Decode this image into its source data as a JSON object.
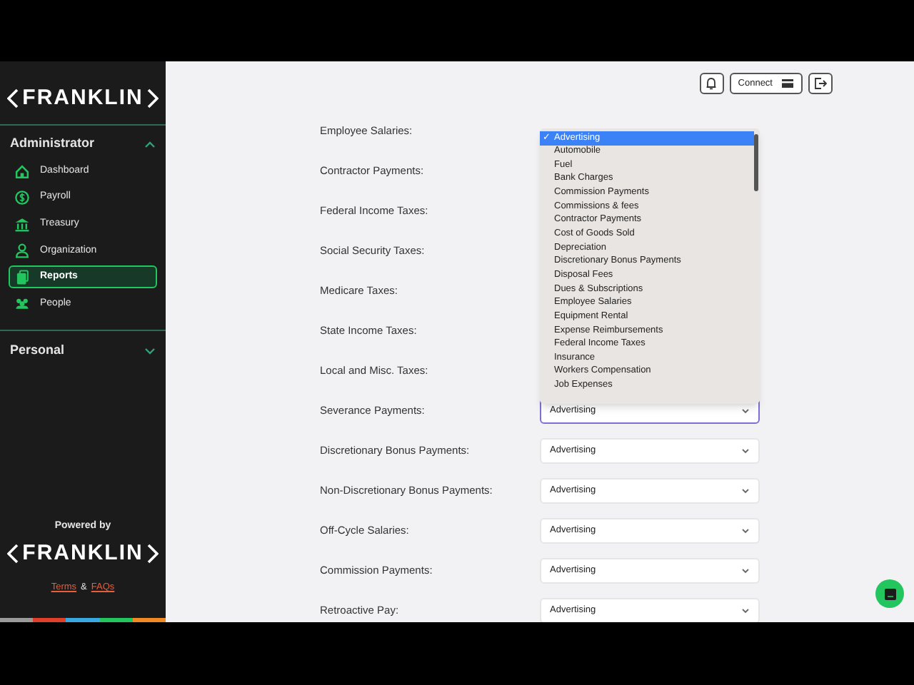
{
  "sidebar": {
    "logo": "FRANKLIN",
    "sections": [
      {
        "title": "Administrator",
        "expanded": true,
        "items": [
          {
            "label": "Dashboard",
            "selected": false
          },
          {
            "label": "Payroll",
            "selected": false
          },
          {
            "label": "Treasury",
            "selected": false
          },
          {
            "label": "Organization",
            "selected": false
          },
          {
            "label": "Reports",
            "selected": true
          },
          {
            "label": "People",
            "selected": false
          }
        ]
      },
      {
        "title": "Personal",
        "expanded": false
      }
    ],
    "footer": {
      "powered_by": "Powered by",
      "logo": "FRANKLIN",
      "terms": "Terms",
      "amp": "&",
      "faqs": "FAQs"
    }
  },
  "header": {
    "connect": "Connect"
  },
  "rows": [
    {
      "label": "Employee Salaries:"
    },
    {
      "label": "Contractor Payments:"
    },
    {
      "label": "Federal Income Taxes:"
    },
    {
      "label": "Social Security Taxes:"
    },
    {
      "label": "Medicare Taxes:"
    },
    {
      "label": "State Income Taxes:"
    },
    {
      "label": "Local and Misc. Taxes:"
    },
    {
      "label": "Severance Payments:",
      "value": "Advertising",
      "focused": true
    },
    {
      "label": "Discretionary Bonus Payments:",
      "value": "Advertising",
      "focused": false
    },
    {
      "label": "Non-Discretionary Bonus Payments:",
      "value": "Advertising",
      "focused": false
    },
    {
      "label": "Off-Cycle Salaries:",
      "value": "Advertising",
      "focused": false
    },
    {
      "label": "Commission Payments:",
      "value": "Advertising",
      "focused": false
    },
    {
      "label": "Retroactive Pay:",
      "value": "Advertising",
      "focused": false
    }
  ],
  "dropdown": {
    "options": [
      {
        "label": "Advertising",
        "selected": true
      },
      {
        "label": "Automobile",
        "selected": false
      },
      {
        "label": "Fuel",
        "selected": false
      },
      {
        "label": "Bank Charges",
        "selected": false
      },
      {
        "label": "Commission Payments",
        "selected": false
      },
      {
        "label": "Commissions & fees",
        "selected": false
      },
      {
        "label": "Contractor Payments",
        "selected": false
      },
      {
        "label": "Cost of Goods Sold",
        "selected": false
      },
      {
        "label": "Depreciation",
        "selected": false
      },
      {
        "label": "Discretionary Bonus Payments",
        "selected": false
      },
      {
        "label": "Disposal Fees",
        "selected": false
      },
      {
        "label": "Dues & Subscriptions",
        "selected": false
      },
      {
        "label": "Employee Salaries",
        "selected": false
      },
      {
        "label": "Equipment Rental",
        "selected": false
      },
      {
        "label": "Expense Reimbursements",
        "selected": false
      },
      {
        "label": "Federal Income Taxes",
        "selected": false
      },
      {
        "label": "Insurance",
        "selected": false
      },
      {
        "label": "Workers Compensation",
        "selected": false
      },
      {
        "label": "Job Expenses",
        "selected": false
      }
    ],
    "check": "✓"
  }
}
